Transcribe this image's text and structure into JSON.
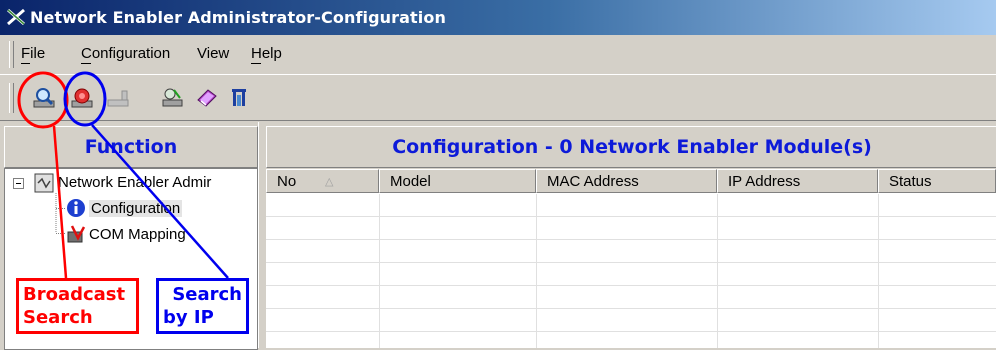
{
  "window": {
    "title": "Network Enabler Administrator-Configuration"
  },
  "menu": [
    "File",
    "Configuration",
    "View",
    "Help"
  ],
  "toolbar": {
    "buttons": [
      "broadcast-search-icon",
      "search-by-ip-icon",
      "disabled-port-icon",
      "network-icon",
      "book-icon",
      "exit-icon"
    ]
  },
  "left_panel": {
    "header": "Function",
    "tree": {
      "root": "Network Enabler Admir",
      "children": [
        "Configuration",
        "COM Mapping"
      ]
    }
  },
  "right_panel": {
    "header": "Configuration - 0 Network Enabler Module(s)",
    "columns": [
      "No",
      "Model",
      "MAC Address",
      "IP Address",
      "Status"
    ]
  },
  "annotations": {
    "broadcast_search": [
      "Broadcast",
      "Search"
    ],
    "search_by_ip": [
      "Search",
      "by IP"
    ]
  },
  "colors": {
    "annotation_red": "#ff0000",
    "annotation_blue": "#0000ee",
    "header_text": "#0d1ad9"
  }
}
